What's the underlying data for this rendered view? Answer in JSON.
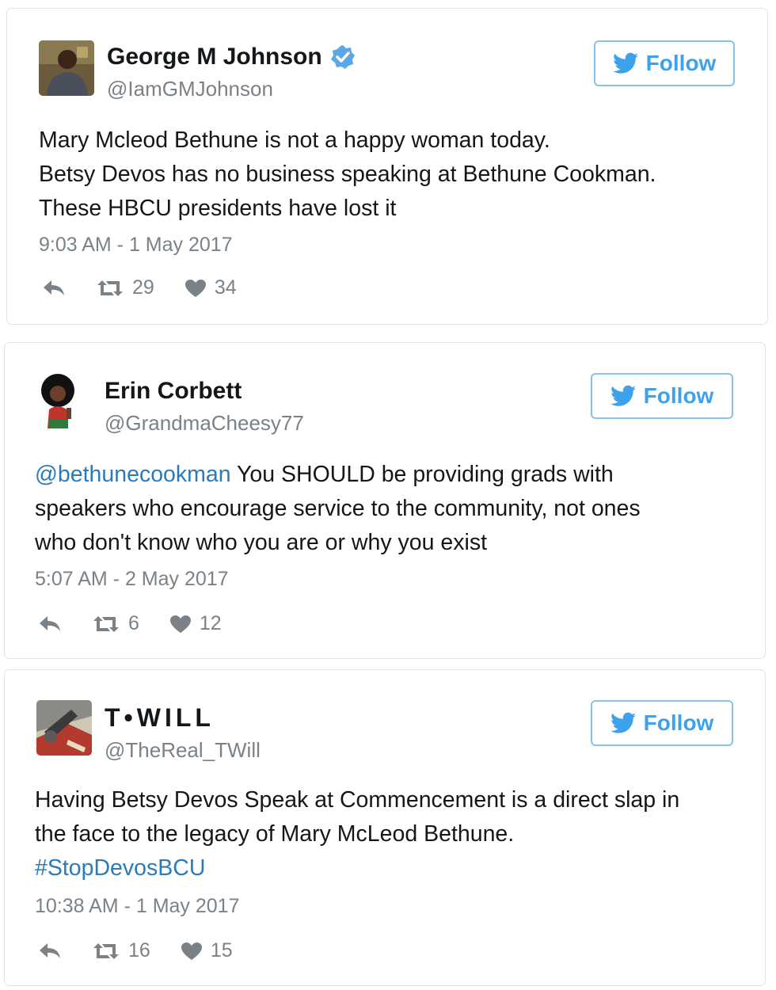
{
  "follow_label": "Follow",
  "icons": {
    "verified": "verified-badge-icon",
    "bird": "twitter-bird-icon",
    "reply": "reply-icon",
    "retweet": "retweet-icon",
    "like": "heart-icon"
  },
  "colors": {
    "link": "#2b7bb9",
    "follow_text": "#3ea1ec",
    "follow_border": "#88c4ea",
    "muted": "#7a8288",
    "verified": "#5aa8e8"
  },
  "tweets": [
    {
      "name": "George M Johnson",
      "verified": true,
      "handle": "@IamGMJohnson",
      "text_prefix": "",
      "text": "Mary Mcleod Bethune is not a happy woman today.\nBetsy Devos has no business speaking at Bethune Cookman.\nThese HBCU presidents have lost it",
      "text_suffix": "",
      "timestamp": "9:03 AM - 1 May 2017",
      "retweets": "29",
      "likes": "34"
    },
    {
      "name": "Erin Corbett",
      "verified": false,
      "handle": "@GrandmaCheesy77",
      "text_prefix": "@bethunecookman",
      "text": " You SHOULD be providing grads with\nspeakers who encourage service to the community, not ones\nwho don't know who you are or why you exist",
      "text_suffix": "",
      "timestamp": "5:07 AM - 2 May 2017",
      "retweets": "6",
      "likes": "12"
    },
    {
      "name": "T•WILL",
      "verified": false,
      "handle": "@TheReal_TWill",
      "text_prefix": "",
      "text": "Having Betsy Devos Speak at Commencement is a direct slap in\nthe face to the legacy of Mary McLeod Bethune.\n",
      "text_suffix": "#StopDevosBCU",
      "timestamp": "10:38 AM - 1 May 2017",
      "retweets": "16",
      "likes": "15"
    }
  ]
}
